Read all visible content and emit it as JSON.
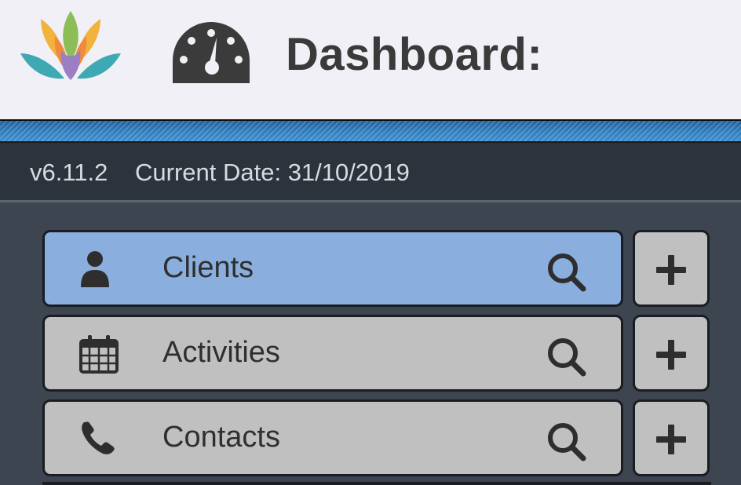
{
  "header": {
    "title": "Dashboard:",
    "logo_icon": "lotus-logo-icon",
    "gauge_icon": "dashboard-gauge-icon"
  },
  "info": {
    "version": "v6.11.2",
    "current_date": "Current Date: 31/10/2019"
  },
  "menu": {
    "items": [
      {
        "label": "Clients",
        "icon": "user-icon",
        "active": true
      },
      {
        "label": "Activities",
        "icon": "calendar-icon",
        "active": false
      },
      {
        "label": "Contacts",
        "icon": "phone-icon",
        "active": false
      }
    ],
    "search_icon": "search-icon",
    "add_icon": "plus-icon"
  },
  "colors": {
    "header_bg": "#f0f0f6",
    "accent_stripe": "#2f7fc0",
    "active_item": "#8aafde",
    "inactive_item": "#c0c0c0",
    "body_bg": "#3d4550"
  }
}
